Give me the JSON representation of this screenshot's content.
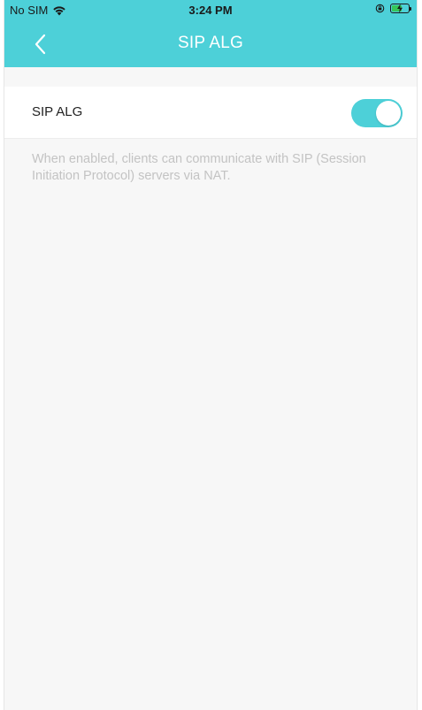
{
  "status_bar": {
    "carrier": "No SIM",
    "time": "3:24 PM",
    "wifi_icon": "wifi-icon",
    "rotation_lock_icon": "rotation-lock-icon",
    "battery_icon": "battery-charging-icon"
  },
  "nav": {
    "back_icon": "chevron-left-icon",
    "title": "SIP ALG"
  },
  "setting": {
    "label": "SIP ALG",
    "enabled": true,
    "description": "When enabled, clients can communicate with SIP (Session Initiation Protocol) servers via NAT."
  },
  "colors": {
    "accent": "#4dd0d8",
    "background": "#f7f7f7",
    "row_background": "#ffffff",
    "description_text": "#c3c3c3",
    "battery_fill": "#36c559"
  }
}
